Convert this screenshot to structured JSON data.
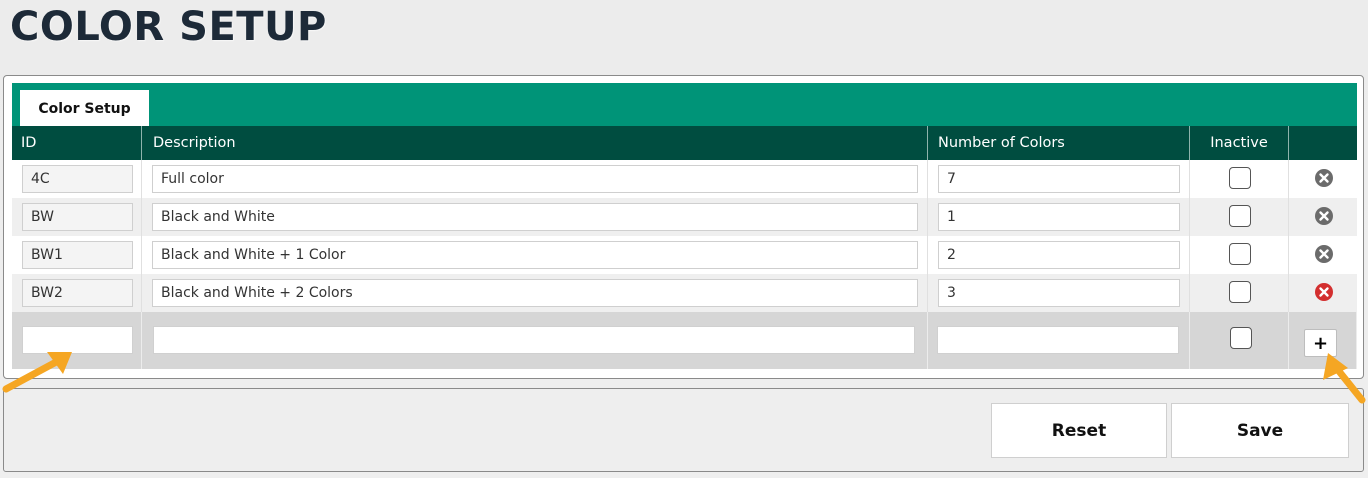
{
  "page": {
    "title": "COLOR SETUP"
  },
  "tabs": [
    {
      "label": "Color Setup"
    }
  ],
  "table": {
    "headers": {
      "id": "ID",
      "description": "Description",
      "number_of_colors": "Number of Colors",
      "inactive": "Inactive"
    },
    "rows": [
      {
        "id": "4C",
        "description": "Full color",
        "number_of_colors": "7",
        "inactive": false,
        "delete_icon": "gray-x-circle-icon"
      },
      {
        "id": "BW",
        "description": "Black and White",
        "number_of_colors": "1",
        "inactive": false,
        "delete_icon": "gray-x-circle-icon"
      },
      {
        "id": "BW1",
        "description": "Black and White + 1 Color",
        "number_of_colors": "2",
        "inactive": false,
        "delete_icon": "gray-x-circle-icon"
      },
      {
        "id": "BW2",
        "description": "Black and White + 2 Colors",
        "number_of_colors": "3",
        "inactive": false,
        "delete_icon": "red-x-circle-icon"
      }
    ],
    "new_row": {
      "id": "",
      "description": "",
      "number_of_colors": "",
      "inactive": false,
      "add_label": "+"
    }
  },
  "footer": {
    "reset_label": "Reset",
    "save_label": "Save"
  },
  "colors": {
    "tab_bar": "#009478",
    "header": "#004d40",
    "delete_gray": "#6b6b6b",
    "delete_red": "#d32f2f",
    "arrow": "#f5a623"
  }
}
